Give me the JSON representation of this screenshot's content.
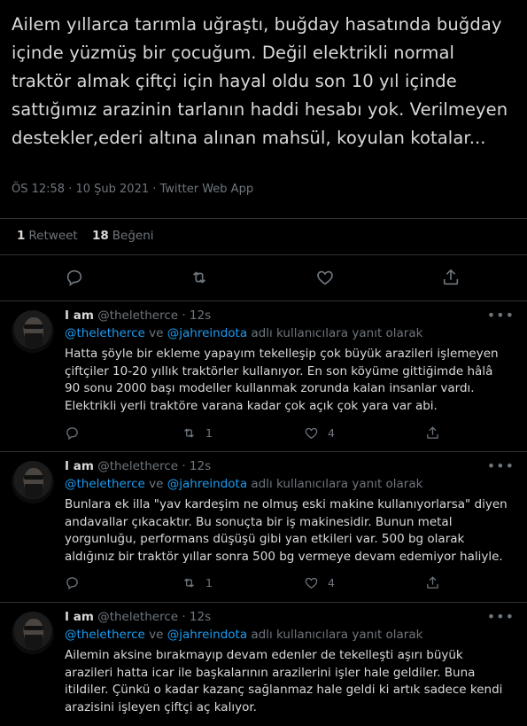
{
  "main": {
    "text": "Ailem yıllarca tarımla uğraştı, buğday hasatında buğday içinde yüzmüş bir çocuğum. Değil elektrikli normal traktör almak çiftçi için hayal oldu son 10 yıl içinde sattığımız arazinin tarlanın haddi hesabı yok. Verilmeyen destekler,ederi altına alınan mahsül, koyulan kotalar...",
    "meta": "ÖS 12:58 · 10 Şub 2021 · Twitter Web App",
    "retweet_count": "1",
    "retweet_label": "Retweet",
    "like_count": "18",
    "like_label": "Beğeni"
  },
  "replies": [
    {
      "name": "I am",
      "handle": "@theletherce · 12s",
      "mention1": "@theletherce",
      "connector": " ve ",
      "mention2": "@jahreindota",
      "reply_suffix": " adlı kullanıcılara yanıt olarak",
      "text": "Hatta şöyle bir ekleme yapayım tekelleşip çok büyük arazileri işlemeyen çiftçiler 10-20 yıllık traktörler kullanıyor. En son köyüme gittiğimde hâlâ 90 sonu 2000 başı modeller kullanmak zorunda kalan insanlar vardı. Elektrikli yerli traktöre varana kadar çok açık çok yara var abi.",
      "retweets": "1",
      "likes": "4"
    },
    {
      "name": "I am",
      "handle": "@theletherce · 12s",
      "mention1": "@theletherce",
      "connector": " ve ",
      "mention2": "@jahreindota",
      "reply_suffix": " adlı kullanıcılara yanıt olarak",
      "text": "Bunlara ek illa \"yav kardeşim ne olmuş eski makine kullanıyorlarsa\" diyen andavallar çıkacaktır. Bu sonuçta bir iş makinesidir. Bunun metal yorgunluğu, performans düşüşü gibi yan etkileri var. 500 bg olarak aldığınız bir traktör yıllar sonra 500 bg vermeye devam edemiyor haliyle.",
      "retweets": "1",
      "likes": "4"
    },
    {
      "name": "I am",
      "handle": "@theletherce · 12s",
      "mention1": "@theletherce",
      "connector": " ve ",
      "mention2": "@jahreindota",
      "reply_suffix": " adlı kullanıcılara yanıt olarak",
      "text": "Ailemin aksine bırakmayıp devam edenler de tekelleşti aşırı büyük arazileri hatta icar ile başkalarının arazilerini işler hale geldiler. Buna itildiler. Çünkü o kadar kazanç sağlanmaz hale geldi ki artık sadece kendi arazisini işleyen çiftçi aç kalıyor.",
      "retweets": "",
      "likes": ""
    }
  ]
}
